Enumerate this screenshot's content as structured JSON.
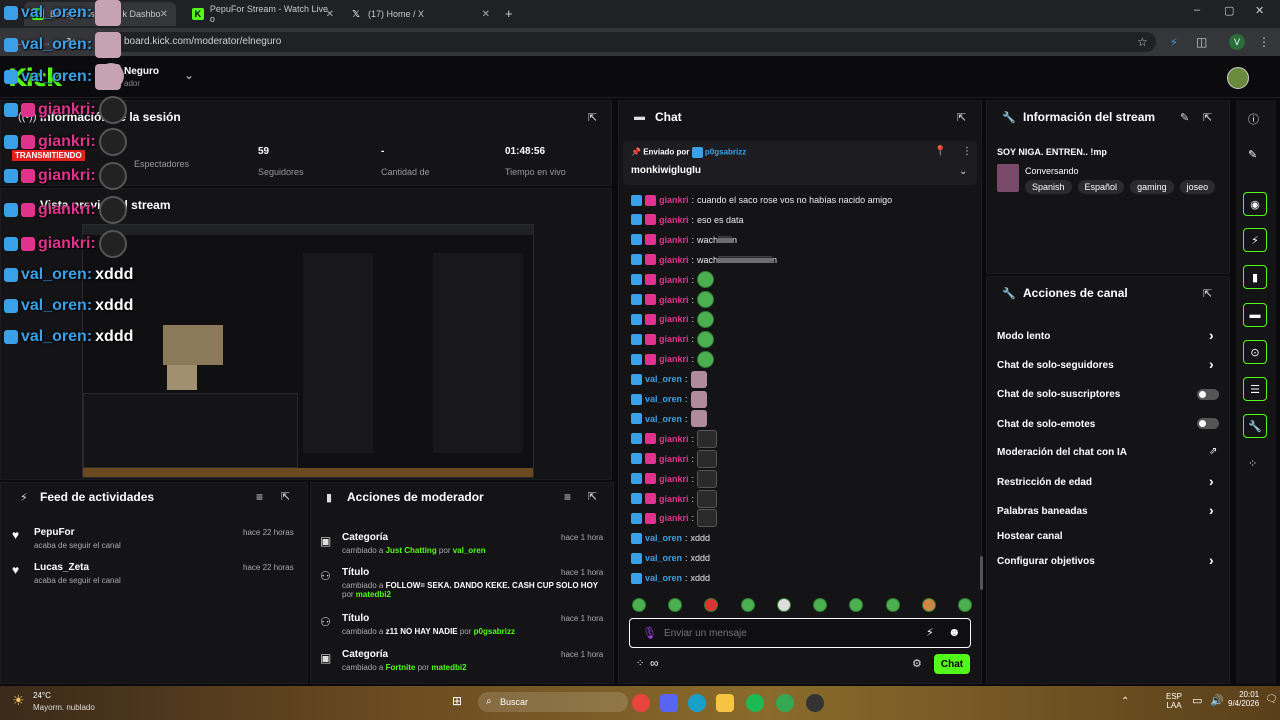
{
  "browser": {
    "tabs": [
      {
        "label": "ElNeguro sobre... k Dashbo"
      },
      {
        "label": "PepuFor Stream - Watch Live o"
      },
      {
        "label": "(17) Home / X"
      }
    ],
    "new_tab": "+",
    "url": "board.kick.com/moderator/elneguro",
    "profile_initial": "V"
  },
  "header": {
    "logo": "Kick",
    "channel": "Neguro",
    "role": "ador"
  },
  "overlay": {
    "lines": [
      {
        "user": "val_oren:",
        "cls": "b"
      },
      {
        "user": "val_oren:",
        "cls": "b"
      },
      {
        "user": "val_oren:",
        "cls": "b"
      },
      {
        "user": "giankri:",
        "cls": "k"
      },
      {
        "user": "giankri:",
        "cls": "k"
      },
      {
        "user": "giankri:",
        "cls": "k"
      },
      {
        "user": "giankri:",
        "cls": "k"
      },
      {
        "user": "giankri:",
        "cls": "k"
      },
      {
        "user": "val_oren:",
        "msg": "xddd",
        "cls": "b"
      },
      {
        "user": "val_oren:",
        "msg": "xddd",
        "cls": "b"
      },
      {
        "user": "val_oren:",
        "msg": "xddd",
        "cls": "b"
      }
    ],
    "live_badge": "TRANSMITIENDO"
  },
  "session": {
    "title": "Información de la sesión",
    "stats": [
      {
        "value": "",
        "label": "Espectadores"
      },
      {
        "value": "59",
        "label": "Seguidores"
      },
      {
        "value": "-",
        "label": "Cantidad de suscripciones"
      },
      {
        "value": "01:48:56",
        "label": "Tiempo en vivo"
      }
    ]
  },
  "preview": {
    "title": "Vista previa del stream"
  },
  "feed": {
    "title": "Feed de actividades",
    "items": [
      {
        "name": "PepuFor",
        "desc": "acaba de seguir el canal",
        "time": "hace 22 horas"
      },
      {
        "name": "Lucas_Zeta",
        "desc": "acaba de seguir el canal",
        "time": "hace 22 horas"
      }
    ]
  },
  "mod_actions": {
    "title": "Acciones de moderador",
    "items": [
      {
        "type": "Categoría",
        "pre": "cambiado a ",
        "val": "Just Chatting",
        "by": " por ",
        "user": "val_oren",
        "time": "hace 1 hora"
      },
      {
        "type": "Título",
        "pre": "cambiado a ",
        "val": "FOLLOW= SEKA. DANDO KEKE. CASH CUP SOLO HOY",
        "by": " por ",
        "user": "matedbi2",
        "time": "hace 1 hora"
      },
      {
        "type": "Título",
        "pre": "cambiado a ",
        "val": "z11 NO HAY NADIE",
        "by": " por ",
        "user": "p0gsabrizz",
        "time": "hace 1 hora"
      },
      {
        "type": "Categoría",
        "pre": "cambiado a ",
        "val": "Fortnite",
        "by": " por ",
        "user": "matedbi2",
        "time": "hace 1 hora"
      }
    ]
  },
  "chat": {
    "title": "Chat",
    "pinned": {
      "label": "Enviado por",
      "user": "p0gsabrizz",
      "message": "monkiwiglugIu"
    },
    "messages": [
      {
        "user": "giankri",
        "text": "cuando el saco rose vos no habías nacido amigo",
        "badge": "k"
      },
      {
        "user": "giankri",
        "text": "eso es data",
        "badge": "k"
      },
      {
        "user": "giankri",
        "text": "wachiiiiiiin",
        "badge": "k"
      },
      {
        "user": "giankri",
        "text": "wachiiiiiiiiiiiiiiiiiiiiiiiiiiin",
        "badge": "k"
      },
      {
        "user": "giankri",
        "emote": "frog",
        "badge": "k"
      },
      {
        "user": "giankri",
        "emote": "frog",
        "badge": "k"
      },
      {
        "user": "giankri",
        "emote": "frog",
        "badge": "k"
      },
      {
        "user": "giankri",
        "emote": "frog",
        "badge": "k"
      },
      {
        "user": "giankri",
        "emote": "frog",
        "badge": "k"
      },
      {
        "user": "val_oren",
        "emote": "pink",
        "badge": "b"
      },
      {
        "user": "val_oren",
        "emote": "pink",
        "badge": "b"
      },
      {
        "user": "val_oren",
        "emote": "pink",
        "badge": "b"
      },
      {
        "user": "giankri",
        "emote": "cat",
        "badge": "k"
      },
      {
        "user": "giankri",
        "emote": "cat",
        "badge": "k"
      },
      {
        "user": "giankri",
        "emote": "cat",
        "badge": "k"
      },
      {
        "user": "giankri",
        "emote": "cat",
        "badge": "k"
      },
      {
        "user": "giankri",
        "emote": "cat",
        "badge": "k"
      },
      {
        "user": "val_oren",
        "text": "xddd",
        "badge": "b"
      },
      {
        "user": "val_oren",
        "text": "xddd",
        "badge": "b"
      },
      {
        "user": "val_oren",
        "text": "xddd",
        "badge": "b"
      }
    ],
    "input_placeholder": "Enviar un mensaje",
    "send_label": "Chat",
    "infinity": "∞"
  },
  "stream_info": {
    "title": "Información del stream",
    "stream_title": "SOY NIGA. ENTREN.. !mp",
    "category": "Conversando",
    "tags": [
      "Spanish",
      "Español",
      "gaming",
      "joseo"
    ]
  },
  "channel_actions": {
    "title": "Acciones de canal",
    "items": [
      {
        "label": "Modo lento",
        "control": "chevron"
      },
      {
        "label": "Chat de solo-seguidores",
        "control": "chevron"
      },
      {
        "label": "Chat de solo-suscriptores",
        "control": "toggle"
      },
      {
        "label": "Chat de solo-emotes",
        "control": "toggle"
      },
      {
        "label": "Moderación del chat con IA",
        "control": "external"
      },
      {
        "label": "Restricción de edad",
        "control": "chevron"
      },
      {
        "label": "Palabras baneadas",
        "control": "chevron"
      },
      {
        "label": "Hostear canal",
        "control": "none"
      },
      {
        "label": "Configurar objetivos",
        "control": "chevron"
      }
    ]
  },
  "taskbar": {
    "weather_temp": "24°C",
    "weather_desc": "Mayorm. nublado",
    "search": "Buscar",
    "lang1": "ESP",
    "lang2": "LAA",
    "time": "20:01",
    "date": "9/4/2026"
  },
  "colors": {
    "accent": "#53fc18",
    "bg": "#0b0b0d",
    "panel": "#141417"
  }
}
